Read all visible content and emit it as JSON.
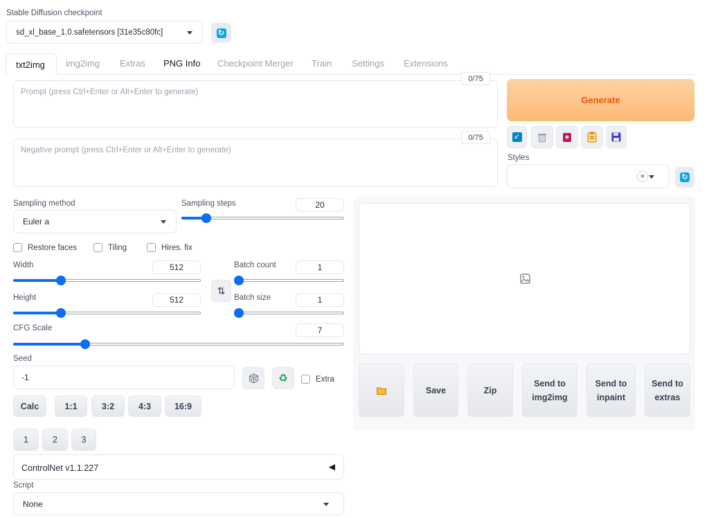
{
  "checkpoint": {
    "label": "Stable Diffusion checkpoint",
    "value": "sd_xl_base_1.0.safetensors [31e35c80fc]",
    "refresh_icon": "refresh-icon"
  },
  "tabs": [
    "txt2img",
    "img2img",
    "Extras",
    "PNG Info",
    "Checkpoint Merger",
    "Train",
    "Settings",
    "Extensions"
  ],
  "active_tab": "txt2img",
  "prompt": {
    "placeholder": "Prompt (press Ctrl+Enter or Alt+Enter to generate)",
    "counter": "0/75"
  },
  "negative_prompt": {
    "placeholder": "Negative prompt (press Ctrl+Enter or Alt+Enter to generate)",
    "counter": "0/75"
  },
  "generate": {
    "label": "Generate",
    "color": "#ea580c"
  },
  "tool_icons": [
    "read-params-icon",
    "trash-icon",
    "extra-networks-icon",
    "clipboard-icon",
    "save-style-icon"
  ],
  "styles": {
    "label": "Styles",
    "clear_glyph": "×"
  },
  "sampling_method": {
    "label": "Sampling method",
    "value": "Euler a"
  },
  "sampling_steps": {
    "label": "Sampling steps",
    "value": "20",
    "fraction": 0.13
  },
  "checkboxes": {
    "restore_faces": "Restore faces",
    "tiling": "Tiling",
    "hires_fix": "Hires. fix"
  },
  "width": {
    "label": "Width",
    "value": "512",
    "fraction": 0.24
  },
  "height": {
    "label": "Height",
    "value": "512",
    "fraction": 0.24
  },
  "swap_icon": "swap-dimensions-icon",
  "swap_glyph": "⇅",
  "batch_count": {
    "label": "Batch count",
    "value": "1",
    "fraction": 0.0
  },
  "batch_size": {
    "label": "Batch size",
    "value": "1",
    "fraction": 0.0
  },
  "cfg_scale": {
    "label": "CFG Scale",
    "value": "7",
    "fraction": 0.21
  },
  "seed": {
    "label": "Seed",
    "value": "-1",
    "extra_label": "Extra",
    "dice_icon": "dice-icon",
    "recycle_icon": "recycle-icon",
    "recycle_glyph": "♻"
  },
  "aspect_buttons": [
    "Calc",
    "1:1",
    "3:2",
    "4:3",
    "16:9"
  ],
  "number_buttons": [
    "1",
    "2",
    "3"
  ],
  "controlnet": {
    "label": "ControlNet v1.1.227",
    "toggle_glyph": "◀"
  },
  "script": {
    "label": "Script",
    "value": "None"
  },
  "output": {
    "image_placeholder_icon": "image-icon",
    "folder_icon": "folder-icon",
    "buttons": [
      "Save",
      "Zip",
      "Send to img2img",
      "Send to inpaint",
      "Send to extras"
    ]
  }
}
